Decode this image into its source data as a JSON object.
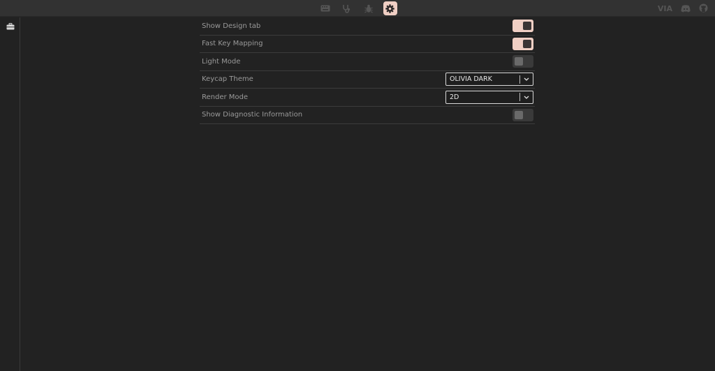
{
  "app": {
    "logo": "VIA"
  },
  "topnav": {
    "items": [
      {
        "name": "configure",
        "icon": "keyboard-icon",
        "active": false
      },
      {
        "name": "key-tester",
        "icon": "stethoscope-icon",
        "active": false
      },
      {
        "name": "design",
        "icon": "bug-icon",
        "active": false
      },
      {
        "name": "settings",
        "icon": "gear-icon",
        "active": true
      }
    ],
    "external_links": [
      {
        "icon": "discord-icon"
      },
      {
        "icon": "github-icon"
      }
    ]
  },
  "sidebar": {
    "items": [
      {
        "icon": "toolbox-icon"
      }
    ]
  },
  "settings": {
    "rows": [
      {
        "label": "Show Design tab",
        "control": "toggle",
        "value": true
      },
      {
        "label": "Fast Key Mapping",
        "control": "toggle",
        "value": true
      },
      {
        "label": "Light Mode",
        "control": "toggle",
        "value": false
      },
      {
        "label": "Keycap Theme",
        "control": "select",
        "value": "OLIVIA DARK"
      },
      {
        "label": "Render Mode",
        "control": "select",
        "value": "2D"
      },
      {
        "label": "Show Diagnostic Information",
        "control": "toggle",
        "value": false
      }
    ]
  },
  "colors": {
    "background": "#222222",
    "topbar": "#323232",
    "accent": "#f0cfc4",
    "text_muted": "#9a9a9a",
    "divider": "#3b3b3b"
  }
}
